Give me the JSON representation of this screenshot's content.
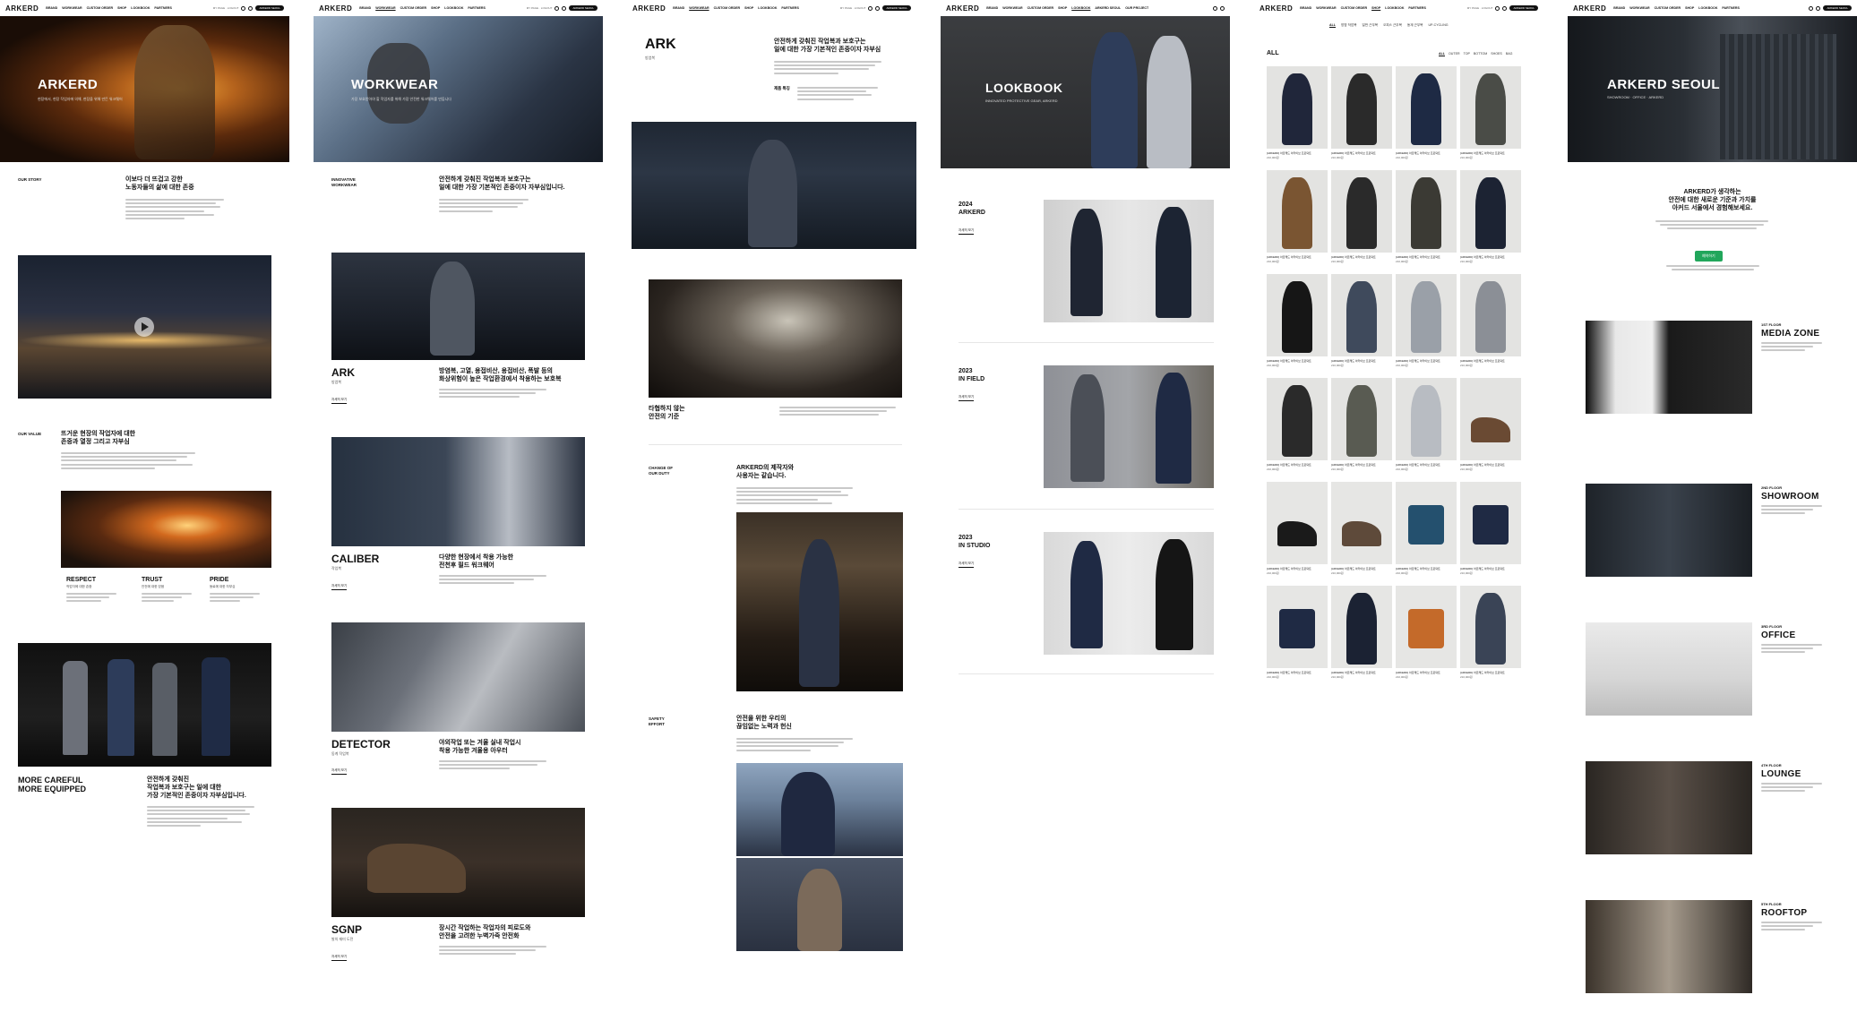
{
  "nav": {
    "logo": "ARKERD",
    "items": [
      "BRAND",
      "WORKWEAR",
      "CUSTOM ORDER",
      "SHOP",
      "LOOKBOOK",
      "PARTNERS"
    ],
    "items_p4": [
      "BRAND",
      "WORKWEAR",
      "CUSTOM ORDER",
      "SHOP",
      "LOOKBOOK",
      "ARKERD SEOUL",
      "OUR PROJECT"
    ],
    "util_text": "MY PAGE · LOGOUT",
    "pill": "ARKERD SEOUL"
  },
  "p1": {
    "hero_title": "ARKERD",
    "hero_sub": "현장에서, 현장 작업자에 의해, 현장을 위해 만든 워크웨어",
    "story_label": "OUR STORY",
    "story_heading": [
      "이보다 더 뜨겁고 강한",
      "노동자들의 삶에 대한 존중"
    ],
    "value_label": "OUR VALUE",
    "value_heading": [
      "뜨거운 현장의 작업자에 대한",
      "존중과 열정 그리고 자부심"
    ],
    "values": [
      {
        "title": "RESPECT",
        "sub": "작업자에 대한 존중"
      },
      {
        "title": "TRUST",
        "sub": "안전에 대한 믿음"
      },
      {
        "title": "PRIDE",
        "sub": "동료에 대한 자부심"
      }
    ],
    "closing_title": [
      "MORE CAREFUL",
      "MORE EQUIPPED"
    ],
    "closing_heading": [
      "안전하게 갖춰진",
      "작업복과 보호구는 일에 대한",
      "가장 기본적인 존중이자 자부심입니다."
    ]
  },
  "p2": {
    "hero_title": "WORKWEAR",
    "hero_sub": "가장 보호받아야 할 작업자를 위해 가장 안전한 워크웨어를 만듭니다",
    "intro_label": [
      "INNOVATIVE",
      "WORKWEAR"
    ],
    "intro_heading": [
      "안전하게 갖춰진 작업복과 보호구는",
      "일에 대한 가장 기본적인 존중이자 자부심입니다."
    ],
    "lines": [
      {
        "name": "ARK",
        "sub": "방염복",
        "heading": [
          "방염복, 고열, 용접비산, 용접비산, 폭발 등의",
          "화상위험이 높은 작업환경에서 착용하는 보호복"
        ],
        "link": "자세히 보기"
      },
      {
        "name": "CALIBER",
        "sub": "작업복",
        "heading": [
          "다양한 현장에서 착용 가능한",
          "전천후 필드 워크웨어"
        ],
        "link": "자세히 보기"
      },
      {
        "name": "DETECTOR",
        "sub": "동계 작업복",
        "heading": [
          "야외작업 또는 겨울 실내 작업시",
          "착용 가능한 겨울용 아우터"
        ],
        "link": "자세히 보기"
      },
      {
        "name": "SGNP",
        "sub": "발의 재미 도전",
        "heading": [
          "장시간 작업하는 작업자의 피로도와",
          "안전을 고려한 누벽가죽 안전화"
        ],
        "link": "자세히 보기"
      }
    ]
  },
  "p3": {
    "title": "ARK",
    "title_sub": "방염복",
    "heading": [
      "안전하게 갖춰진 작업복과 보호구는",
      "일에 대한 가장 기본적인 존중이자 자부심"
    ],
    "spec_label": "제품 특징",
    "caption": [
      "타협하지 않는",
      "안전의 기준"
    ],
    "duty_label": [
      "CHANGE OF",
      "OUR DUTY"
    ],
    "duty_heading": [
      "ARKERD의 제작자와",
      "사용자는 같습니다."
    ],
    "safety_label": [
      "SAFETY",
      "EFFORT"
    ],
    "safety_heading": [
      "안전을 위한 우리의",
      "끊임없는 노력과 헌신"
    ]
  },
  "p4": {
    "hero_title": "LOOKBOOK",
    "hero_sub": "INNOVATED PROTECTIVE GEAR, ARKERD",
    "entries": [
      {
        "year": "2024",
        "name": "ARKERD",
        "link": "자세히 보기"
      },
      {
        "year": "2023",
        "name": "IN FIELD",
        "link": "자세히 보기"
      },
      {
        "year": "2023",
        "name": "IN STUDIO",
        "link": "자세히 보기"
      }
    ]
  },
  "p5": {
    "tabs": [
      "ALL",
      "방염 작업복",
      "일반 근무복",
      "오피스 근무복",
      "동계 근무복",
      "UP-CYCLING"
    ],
    "section_title": "ALL",
    "filters": [
      "ALL",
      "OUTER",
      "TOP",
      "BOTTOM",
      "SHOES",
      "BAG"
    ],
    "product_name": "[ARKERD] 아르케드 아카이브 프로덕트",
    "product_price": "210,000원"
  },
  "p6": {
    "hero_title": "ARKERD SEOUL",
    "hero_sub": "SHOWROOM · OFFICE · ARKERD",
    "intro_heading": [
      "ARKERD가 생각하는",
      "안전에 대한 새로운 기준과 가치를",
      "아커드 서울에서 경험해보세요."
    ],
    "button": "예약하기",
    "floors": [
      {
        "floor": "1ST FLOOR",
        "name": "MEDIA ZONE"
      },
      {
        "floor": "2ND FLOOR",
        "name": "SHOWROOM"
      },
      {
        "floor": "3RD FLOOR",
        "name": "OFFICE"
      },
      {
        "floor": "4TH FLOOR",
        "name": "LOUNGE"
      },
      {
        "floor": "5TH FLOOR",
        "name": "ROOFTOP"
      }
    ]
  }
}
